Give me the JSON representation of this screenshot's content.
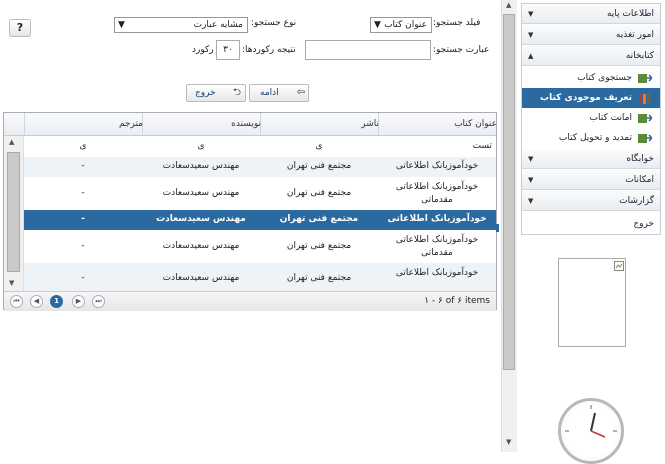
{
  "form": {
    "help_label": "?",
    "search_field_label": "فیلد جستجو:",
    "search_field_value": "عنوان کتاب",
    "search_type_label": "نوع جستجو:",
    "search_type_value": "مشابه عبارت",
    "search_phrase_label": "عبارت جستجو:",
    "search_phrase_value": "",
    "records_label": "نتیجه رکوردها:",
    "records_value": "۳۰",
    "records_unit": "رکورد",
    "continue_label": "ادامه",
    "exit_label": "خروج"
  },
  "grid": {
    "columns": [
      "عنوان کتاب",
      "ناشر",
      "نویسنده",
      "مترجم"
    ],
    "rows": [
      [
        "تست",
        "ی",
        "ی",
        "ی"
      ],
      [
        "خودآموزبانک اطلاعاتی",
        "مجتمع فنی تهران",
        "مهندس سعیدسعادت",
        "-"
      ],
      [
        "خودآموزبانک اطلاعاتی مقدماتی",
        "مجتمع فنی تهران",
        "مهندس سعیدسعادت",
        "-"
      ],
      [
        "خودآموزبانک اطلاعاتی",
        "مجتمع فنی تهران",
        "مهندس سعیدسعادت",
        "-"
      ],
      [
        "خودآموزبانک اطلاعاتی مقدماتی",
        "مجتمع فنی تهران",
        "مهندس سعیدسعادت",
        "-"
      ],
      [
        "خودآموزبانک اطلاعاتی",
        "مجتمع فنی تهران",
        "مهندس سعیدسعادت",
        "-"
      ]
    ],
    "pager_text": "۱ - ۶ of ۶ items",
    "current_page": "1"
  },
  "sidebar": {
    "sections": [
      {
        "label": "اطلاعات پایه"
      },
      {
        "label": "امور تغذیه"
      },
      {
        "label": "کتابخانه"
      }
    ],
    "items": [
      {
        "label": "جستجوی کتاب"
      },
      {
        "label": "تعریف موجودی کتاب"
      },
      {
        "label": "امانت کتاب"
      },
      {
        "label": "تمدید و تحویل کتاب"
      }
    ],
    "sections_after": [
      {
        "label": "خوابگاه"
      },
      {
        "label": "امکانات"
      },
      {
        "label": "گزارشات"
      }
    ],
    "exit_label": "خروج"
  },
  "colors": {
    "accent": "#2b6aa0",
    "header_bg": "#e9eef3"
  }
}
